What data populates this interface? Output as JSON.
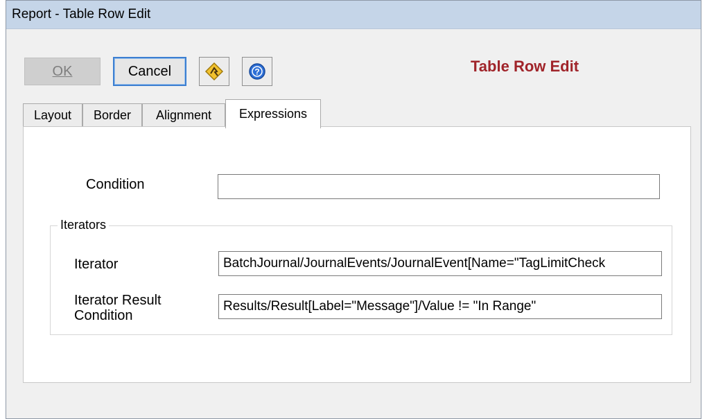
{
  "window": {
    "title": "Report - Table Row Edit"
  },
  "toolbar": {
    "ok_label": "OK",
    "cancel_label": "Cancel",
    "wizard_icon": "wizard-icon",
    "help_icon": "help-icon"
  },
  "heading": "Table Row Edit",
  "tabs": [
    {
      "label": "Layout",
      "active": false
    },
    {
      "label": "Border",
      "active": false
    },
    {
      "label": "Alignment",
      "active": false
    },
    {
      "label": "Expressions",
      "active": true
    }
  ],
  "expressions": {
    "condition_label": "Condition",
    "condition_value": "",
    "iterators_group": "Iterators",
    "iterator_label": "Iterator",
    "iterator_value": "BatchJournal/JournalEvents/JournalEvent[Name=\"TagLimitCheck",
    "iterator_result_label_line1": "Iterator Result",
    "iterator_result_label_line2": "Condition",
    "iterator_result_value": "Results/Result[Label=\"Message\"]/Value != \"In Range\""
  },
  "colors": {
    "titlebar": "#c5d5e8",
    "heading": "#a0242a",
    "focus_border": "#3c7fd1"
  }
}
